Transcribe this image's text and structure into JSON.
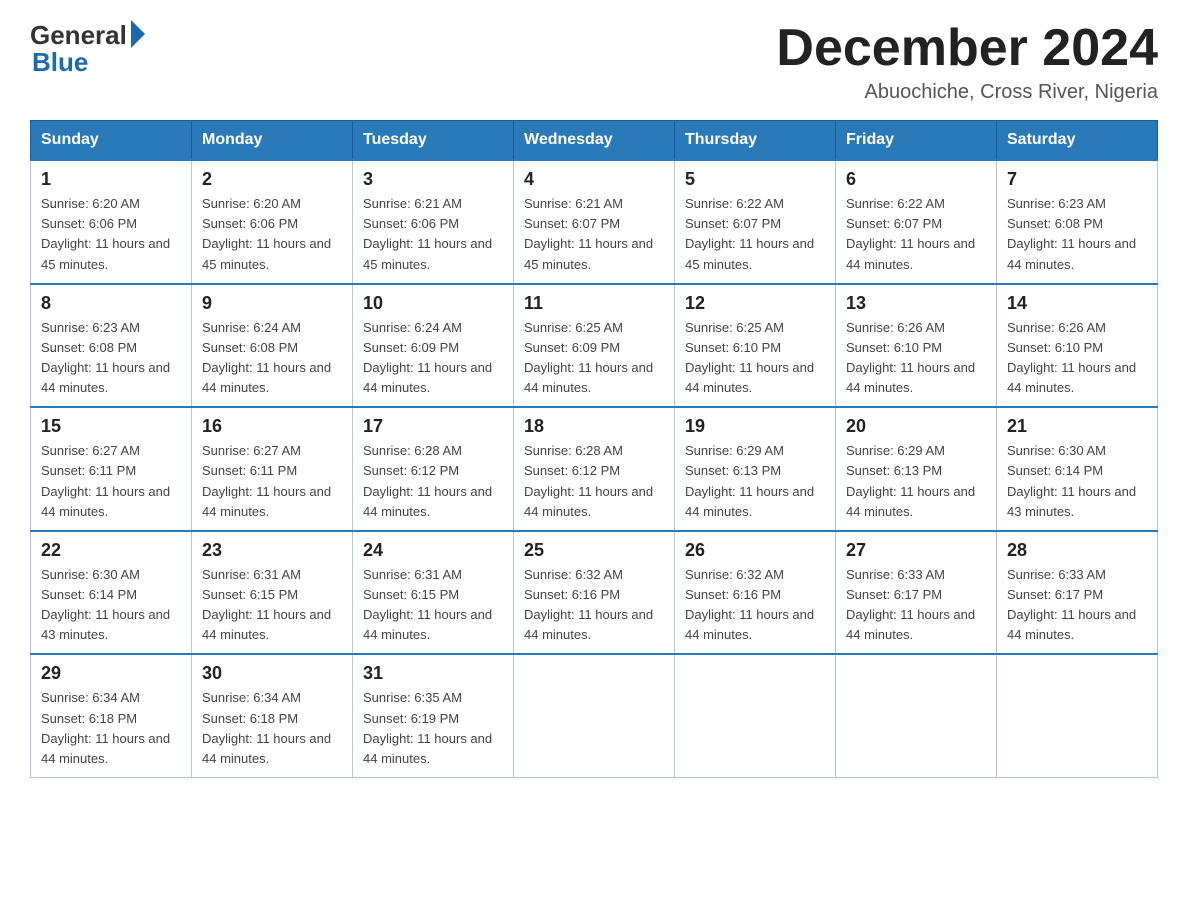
{
  "logo": {
    "general": "General",
    "blue": "Blue"
  },
  "title": {
    "month_year": "December 2024",
    "location": "Abuochiche, Cross River, Nigeria"
  },
  "weekdays": [
    "Sunday",
    "Monday",
    "Tuesday",
    "Wednesday",
    "Thursday",
    "Friday",
    "Saturday"
  ],
  "weeks": [
    [
      {
        "day": "1",
        "sunrise": "6:20 AM",
        "sunset": "6:06 PM",
        "daylight": "11 hours and 45 minutes."
      },
      {
        "day": "2",
        "sunrise": "6:20 AM",
        "sunset": "6:06 PM",
        "daylight": "11 hours and 45 minutes."
      },
      {
        "day": "3",
        "sunrise": "6:21 AM",
        "sunset": "6:06 PM",
        "daylight": "11 hours and 45 minutes."
      },
      {
        "day": "4",
        "sunrise": "6:21 AM",
        "sunset": "6:07 PM",
        "daylight": "11 hours and 45 minutes."
      },
      {
        "day": "5",
        "sunrise": "6:22 AM",
        "sunset": "6:07 PM",
        "daylight": "11 hours and 45 minutes."
      },
      {
        "day": "6",
        "sunrise": "6:22 AM",
        "sunset": "6:07 PM",
        "daylight": "11 hours and 44 minutes."
      },
      {
        "day": "7",
        "sunrise": "6:23 AM",
        "sunset": "6:08 PM",
        "daylight": "11 hours and 44 minutes."
      }
    ],
    [
      {
        "day": "8",
        "sunrise": "6:23 AM",
        "sunset": "6:08 PM",
        "daylight": "11 hours and 44 minutes."
      },
      {
        "day": "9",
        "sunrise": "6:24 AM",
        "sunset": "6:08 PM",
        "daylight": "11 hours and 44 minutes."
      },
      {
        "day": "10",
        "sunrise": "6:24 AM",
        "sunset": "6:09 PM",
        "daylight": "11 hours and 44 minutes."
      },
      {
        "day": "11",
        "sunrise": "6:25 AM",
        "sunset": "6:09 PM",
        "daylight": "11 hours and 44 minutes."
      },
      {
        "day": "12",
        "sunrise": "6:25 AM",
        "sunset": "6:10 PM",
        "daylight": "11 hours and 44 minutes."
      },
      {
        "day": "13",
        "sunrise": "6:26 AM",
        "sunset": "6:10 PM",
        "daylight": "11 hours and 44 minutes."
      },
      {
        "day": "14",
        "sunrise": "6:26 AM",
        "sunset": "6:10 PM",
        "daylight": "11 hours and 44 minutes."
      }
    ],
    [
      {
        "day": "15",
        "sunrise": "6:27 AM",
        "sunset": "6:11 PM",
        "daylight": "11 hours and 44 minutes."
      },
      {
        "day": "16",
        "sunrise": "6:27 AM",
        "sunset": "6:11 PM",
        "daylight": "11 hours and 44 minutes."
      },
      {
        "day": "17",
        "sunrise": "6:28 AM",
        "sunset": "6:12 PM",
        "daylight": "11 hours and 44 minutes."
      },
      {
        "day": "18",
        "sunrise": "6:28 AM",
        "sunset": "6:12 PM",
        "daylight": "11 hours and 44 minutes."
      },
      {
        "day": "19",
        "sunrise": "6:29 AM",
        "sunset": "6:13 PM",
        "daylight": "11 hours and 44 minutes."
      },
      {
        "day": "20",
        "sunrise": "6:29 AM",
        "sunset": "6:13 PM",
        "daylight": "11 hours and 44 minutes."
      },
      {
        "day": "21",
        "sunrise": "6:30 AM",
        "sunset": "6:14 PM",
        "daylight": "11 hours and 43 minutes."
      }
    ],
    [
      {
        "day": "22",
        "sunrise": "6:30 AM",
        "sunset": "6:14 PM",
        "daylight": "11 hours and 43 minutes."
      },
      {
        "day": "23",
        "sunrise": "6:31 AM",
        "sunset": "6:15 PM",
        "daylight": "11 hours and 44 minutes."
      },
      {
        "day": "24",
        "sunrise": "6:31 AM",
        "sunset": "6:15 PM",
        "daylight": "11 hours and 44 minutes."
      },
      {
        "day": "25",
        "sunrise": "6:32 AM",
        "sunset": "6:16 PM",
        "daylight": "11 hours and 44 minutes."
      },
      {
        "day": "26",
        "sunrise": "6:32 AM",
        "sunset": "6:16 PM",
        "daylight": "11 hours and 44 minutes."
      },
      {
        "day": "27",
        "sunrise": "6:33 AM",
        "sunset": "6:17 PM",
        "daylight": "11 hours and 44 minutes."
      },
      {
        "day": "28",
        "sunrise": "6:33 AM",
        "sunset": "6:17 PM",
        "daylight": "11 hours and 44 minutes."
      }
    ],
    [
      {
        "day": "29",
        "sunrise": "6:34 AM",
        "sunset": "6:18 PM",
        "daylight": "11 hours and 44 minutes."
      },
      {
        "day": "30",
        "sunrise": "6:34 AM",
        "sunset": "6:18 PM",
        "daylight": "11 hours and 44 minutes."
      },
      {
        "day": "31",
        "sunrise": "6:35 AM",
        "sunset": "6:19 PM",
        "daylight": "11 hours and 44 minutes."
      },
      null,
      null,
      null,
      null
    ]
  ]
}
